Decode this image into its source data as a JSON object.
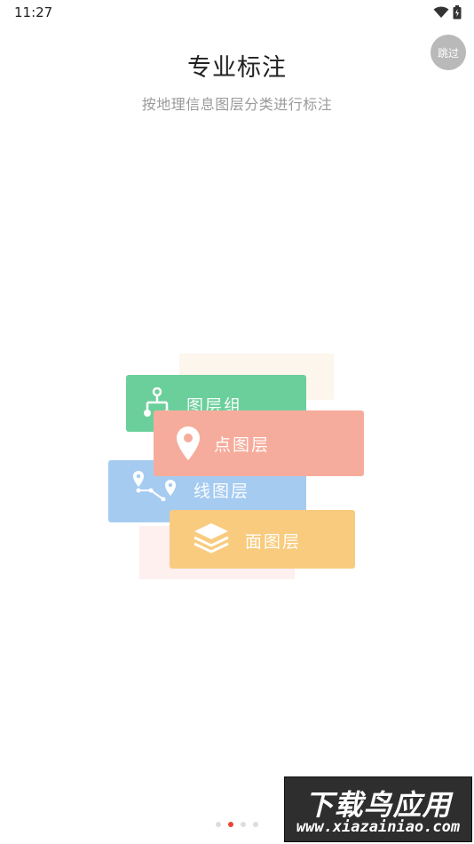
{
  "status_bar": {
    "time": "11:27"
  },
  "skip_label": "跳过",
  "title": "专业标注",
  "subtitle": "按地理信息图层分类进行标注",
  "cards": {
    "layer_group": {
      "label": "图层组",
      "color": "#6bcf9b"
    },
    "point_layer": {
      "label": "点图层",
      "color": "#f6ac9c"
    },
    "line_layer": {
      "label": "线图层",
      "color": "#a6cbf1"
    },
    "polygon_layer": {
      "label": "面图层",
      "color": "#f8cb7e"
    }
  },
  "pager": {
    "total": 4,
    "active_index": 1,
    "active_color": "#e8463a"
  },
  "watermark": {
    "title": "下载鸟应用",
    "url": "www.xiazainiao.com"
  }
}
